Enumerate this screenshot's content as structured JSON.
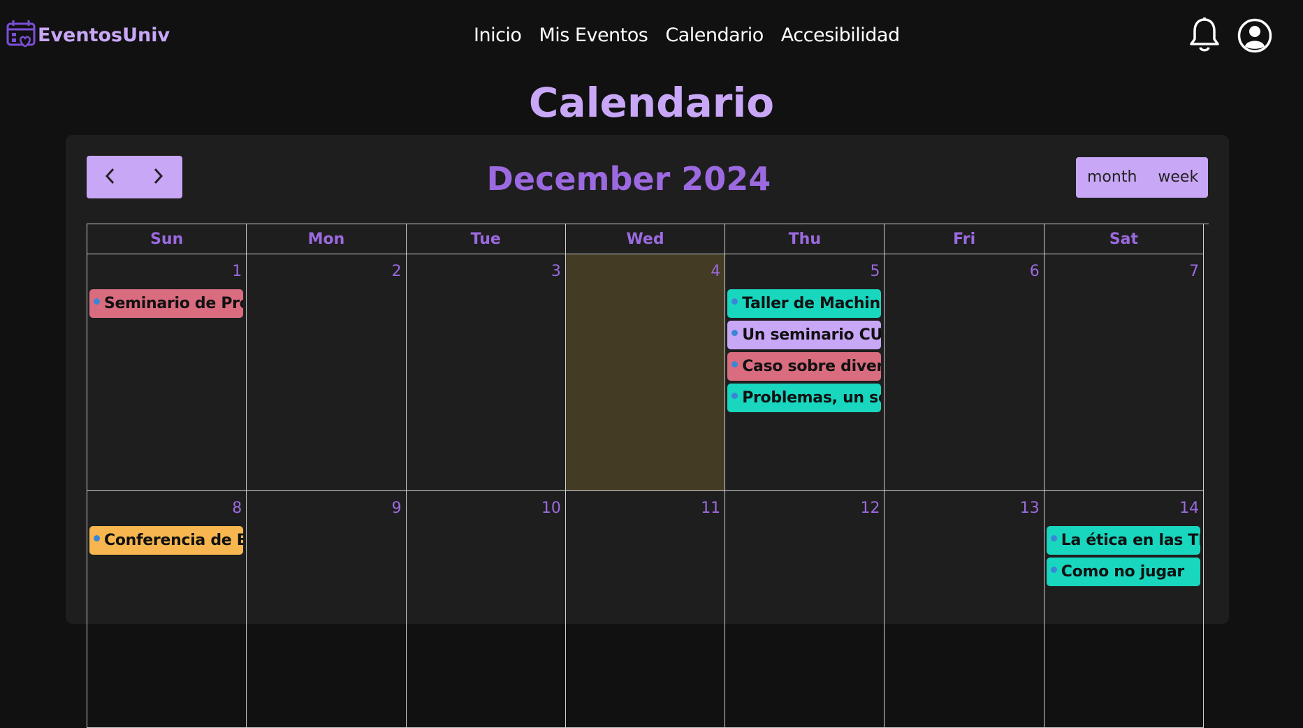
{
  "brand": {
    "name": "EventosUniv"
  },
  "nav": {
    "items": [
      "Inicio",
      "Mis Eventos",
      "Calendario",
      "Accesibilidad"
    ]
  },
  "icons": {
    "bell": "bell-icon",
    "user": "user-circle-icon",
    "prev": "chevron-left-icon",
    "next": "chevron-right-icon",
    "logo": "calendar-heart-icon"
  },
  "page": {
    "title": "Calendario"
  },
  "calendar": {
    "month_title": "December 2024",
    "views": [
      "month",
      "week"
    ],
    "weekdays": [
      "Sun",
      "Mon",
      "Tue",
      "Wed",
      "Thu",
      "Fri",
      "Sat"
    ],
    "today": 4,
    "weeks": [
      [
        {
          "day": "1",
          "events": [
            {
              "title": "Seminario de Programación",
              "color": "#d96c7f"
            }
          ]
        },
        {
          "day": "2",
          "events": []
        },
        {
          "day": "3",
          "events": []
        },
        {
          "day": "4",
          "events": []
        },
        {
          "day": "5",
          "events": [
            {
              "title": "Taller de Machine Learning",
              "color": "#19d6bf"
            },
            {
              "title": "Un seminario CUalquiera",
              "color": "#c9a7f7"
            },
            {
              "title": "Caso sobre diversidad",
              "color": "#d96c7f"
            },
            {
              "title": "Problemas, un solo camino",
              "color": "#19d6bf"
            }
          ]
        },
        {
          "day": "6",
          "events": []
        },
        {
          "day": "7",
          "events": []
        }
      ],
      [
        {
          "day": "8",
          "events": [
            {
              "title": "Conferencia de Big Data",
              "color": "#f7b64f"
            }
          ]
        },
        {
          "day": "9",
          "events": []
        },
        {
          "day": "10",
          "events": []
        },
        {
          "day": "11",
          "events": []
        },
        {
          "day": "12",
          "events": []
        },
        {
          "day": "13",
          "events": []
        },
        {
          "day": "14",
          "events": [
            {
              "title": "La ética en las TIC",
              "color": "#19d6bf"
            },
            {
              "title": "Como no jugar",
              "color": "#19d6bf"
            }
          ]
        }
      ]
    ]
  }
}
